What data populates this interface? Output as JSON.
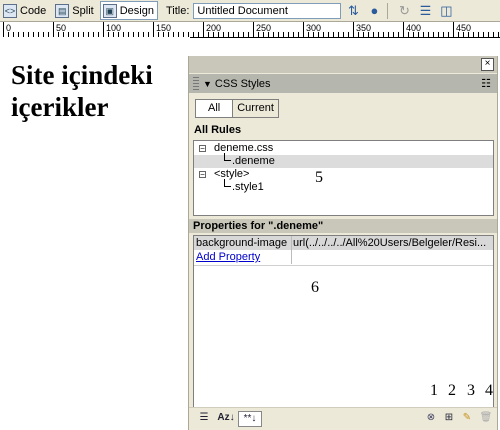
{
  "toolbar": {
    "code_label": "Code",
    "split_label": "Split",
    "design_label": "Design",
    "title_label": "Title:",
    "title_value": "Untitled Document",
    "icons": [
      "file-management-icon",
      "preview-globe-icon",
      "refresh-icon",
      "view-options-icon",
      "visual-aids-icon"
    ]
  },
  "ruler": {
    "labels": [
      "0",
      "50",
      "100",
      "150",
      "200",
      "250",
      "300",
      "350",
      "400",
      "450"
    ]
  },
  "document": {
    "heading": "Site içindeki içerikler"
  },
  "panel": {
    "title": "CSS Styles",
    "tabs": [
      "All",
      "Current"
    ],
    "active_tab": "All",
    "all_rules_label": "All Rules",
    "rules": [
      {
        "label": "deneme.css",
        "level": 0
      },
      {
        "label": ".deneme",
        "level": 1,
        "selected": true
      },
      {
        "label": "<style>",
        "level": 0
      },
      {
        "label": ".style1",
        "level": 1
      }
    ],
    "properties_label": "Properties for \".deneme\"",
    "properties": [
      {
        "name": "background-image",
        "value": "url(../../../../All%20Users/Belgeler/Resi..."
      }
    ],
    "add_property_label": "Add Property",
    "bottom_left_buttons": [
      "category-view-icon",
      "alphabetical-view-icon",
      "set-properties-only-icon"
    ],
    "bottom_right_buttons": [
      "attach-style-sheet-icon",
      "new-css-rule-icon",
      "edit-style-icon",
      "delete-css-rule-icon"
    ]
  },
  "annotations": {
    "rules_marker": "5",
    "properties_marker": "6",
    "button_markers": [
      "1",
      "2",
      "3",
      "4"
    ]
  }
}
